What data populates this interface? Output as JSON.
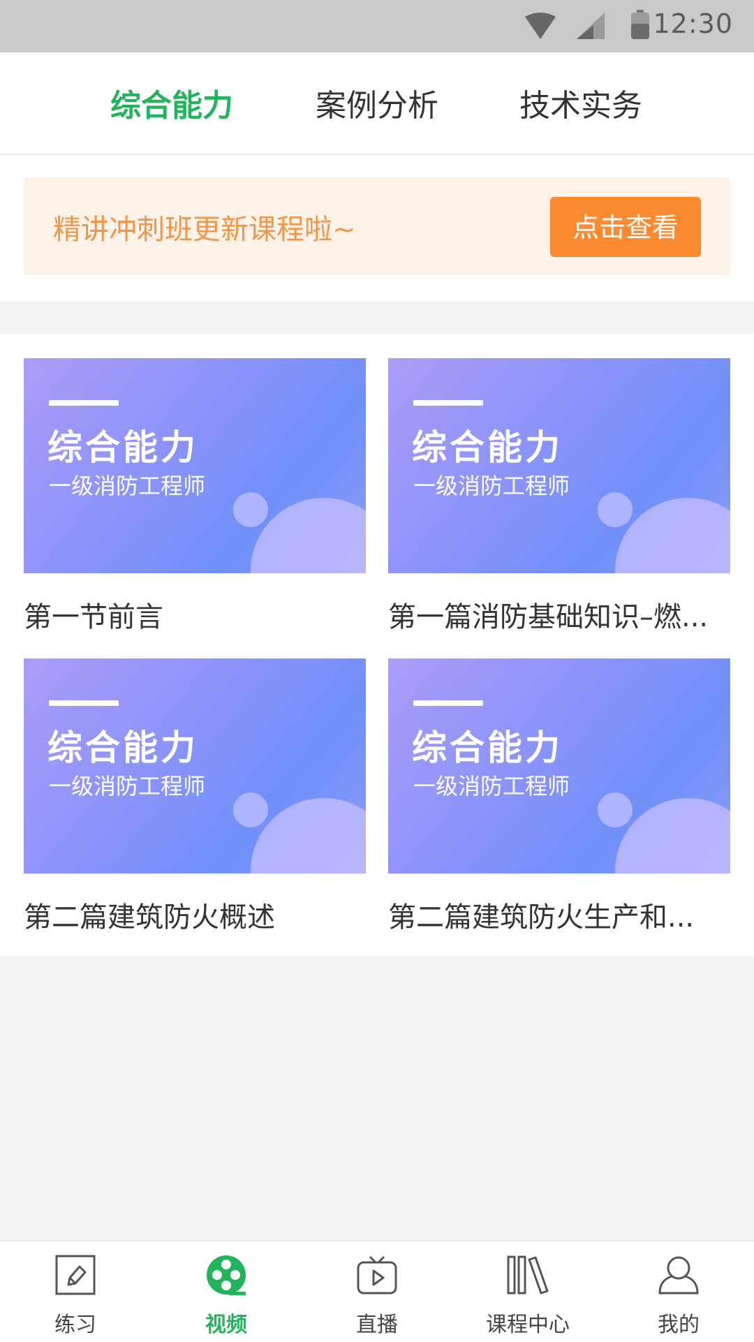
{
  "status_bar": {
    "time": "12:30",
    "icons": [
      "wifi-icon",
      "signal-icon",
      "battery-icon"
    ]
  },
  "top_tabs": [
    {
      "label": "综合能力",
      "active": true
    },
    {
      "label": "案例分析",
      "active": false
    },
    {
      "label": "技术实务",
      "active": false
    }
  ],
  "banner": {
    "text": "精讲冲刺班更新课程啦~",
    "button_label": "点击查看"
  },
  "courses": [
    {
      "thumb_title": "综合能力",
      "thumb_subtitle": "一级消防工程师",
      "title": "第一节前言"
    },
    {
      "thumb_title": "综合能力",
      "thumb_subtitle": "一级消防工程师",
      "title": "第一篇消防基础知识–燃..."
    },
    {
      "thumb_title": "综合能力",
      "thumb_subtitle": "一级消防工程师",
      "title": "第二篇建筑防火概述"
    },
    {
      "thumb_title": "综合能力",
      "thumb_subtitle": "一级消防工程师",
      "title": "第二篇建筑防火生产和..."
    }
  ],
  "bottom_nav": [
    {
      "label": "练习",
      "icon": "pencil-icon",
      "active": false
    },
    {
      "label": "视频",
      "icon": "film-reel-icon",
      "active": true
    },
    {
      "label": "直播",
      "icon": "tv-play-icon",
      "active": false
    },
    {
      "label": "课程中心",
      "icon": "books-icon",
      "active": false
    },
    {
      "label": "我的",
      "icon": "user-icon",
      "active": false
    }
  ],
  "colors": {
    "accent": "#22b45b",
    "banner_bg": "#fdf2e8",
    "banner_text": "#f0964b",
    "banner_button": "#fb8a30",
    "thumb_gradient_start": "#ab9df6",
    "thumb_gradient_end": "#7090fa"
  }
}
